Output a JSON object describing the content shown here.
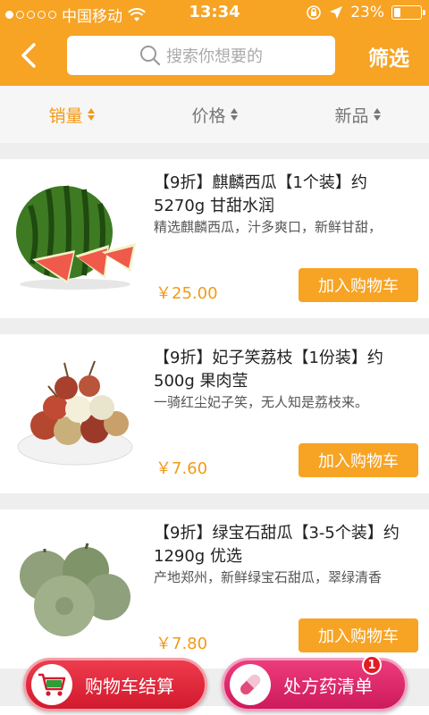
{
  "status": {
    "carrier": "中国移动",
    "time": "13:34",
    "battery": "23%",
    "battery_level": 0.23
  },
  "nav": {
    "search_placeholder": "搜索你想要的",
    "filter_label": "筛选"
  },
  "sort": [
    {
      "label": "销量",
      "active": true
    },
    {
      "label": "价格",
      "active": false
    },
    {
      "label": "新品",
      "active": false
    }
  ],
  "products": [
    {
      "title": "【9折】麒麟西瓜【1个装】约5270g 甘甜水润",
      "desc": "精选麒麟西瓜，汁多爽口，新鲜甘甜，",
      "price": "￥25.00",
      "add_label": "加入购物车"
    },
    {
      "title": "【9折】妃子笑荔枝【1份装】约500g 果肉莹",
      "desc": "一骑红尘妃子笑，无人知是荔枝来。",
      "price": "￥7.60",
      "add_label": "加入购物车"
    },
    {
      "title": "【9折】绿宝石甜瓜【3-5个装】约1290g 优选",
      "desc": "产地郑州，新鲜绿宝石甜瓜，翠绿清香",
      "price": "￥7.80",
      "add_label": "加入购物车"
    }
  ],
  "bottom": {
    "cart_label": "购物车结算",
    "rx_label": "处方药清单",
    "rx_badge": "1"
  },
  "colors": {
    "accent": "#f7a324",
    "price": "#f29a18",
    "cart_red": "#d21a2d",
    "rx_pink": "#cc1a5a"
  }
}
